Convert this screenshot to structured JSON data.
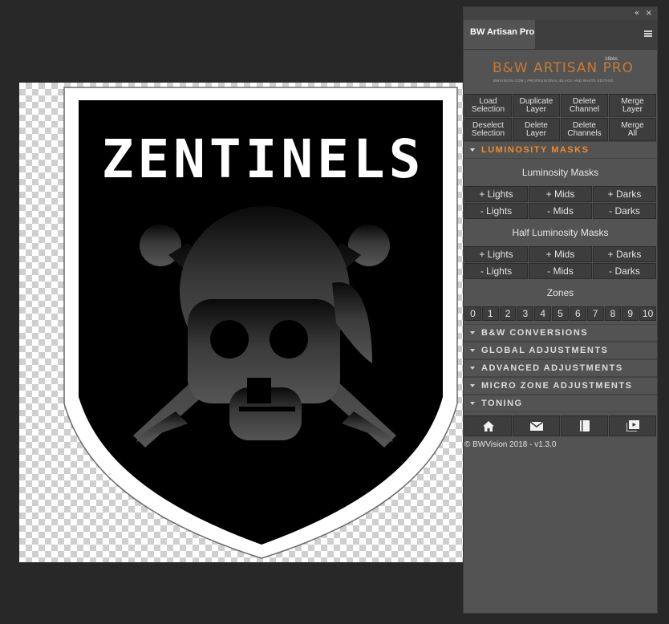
{
  "panel": {
    "tab_title": "BW Artisan Pro",
    "collapse_glyph": "«",
    "close_glyph": "×",
    "brand": {
      "name": "B&W ARTISAN PRO",
      "version": "16bits",
      "tagline": "BWVISION.COM | PROFESSIONAL BLACK AND WHITE EDITING"
    },
    "actions": [
      "Load\nSelection",
      "Duplicate\nLayer",
      "Delete\nChannel",
      "Merge\nLayer",
      "Deselect\nSelection",
      "Delete\nLayer",
      "Delete\nChannels",
      "Merge\nAll"
    ],
    "luminosity_section": {
      "title": "LUMINOSITY MASKS",
      "masks_heading": "Luminosity Masks",
      "masks": [
        "+ Lights",
        "+ Mids",
        "+ Darks",
        "- Lights",
        "- Mids",
        "- Darks"
      ],
      "half_heading": "Half Luminosity Masks",
      "half_masks": [
        "+ Lights",
        "+ Mids",
        "+ Darks",
        "- Lights",
        "- Mids",
        "- Darks"
      ],
      "zones_heading": "Zones",
      "zones": [
        "0",
        "1",
        "2",
        "3",
        "4",
        "5",
        "6",
        "7",
        "8",
        "9",
        "10"
      ]
    },
    "sections": [
      "B&W CONVERSIONS",
      "GLOBAL ADJUSTMENTS",
      "ADVANCED ADJUSTMENTS",
      "MICRO ZONE ADJUSTMENTS",
      "TONING"
    ],
    "footer_icons": [
      "home-icon",
      "mail-icon",
      "book-icon",
      "video-icon"
    ],
    "copyright": "© BWVision 2018 - v1.3.0",
    "accent_color": "#f08a2e"
  },
  "canvas": {
    "logo_text": "ZENTINELS"
  }
}
